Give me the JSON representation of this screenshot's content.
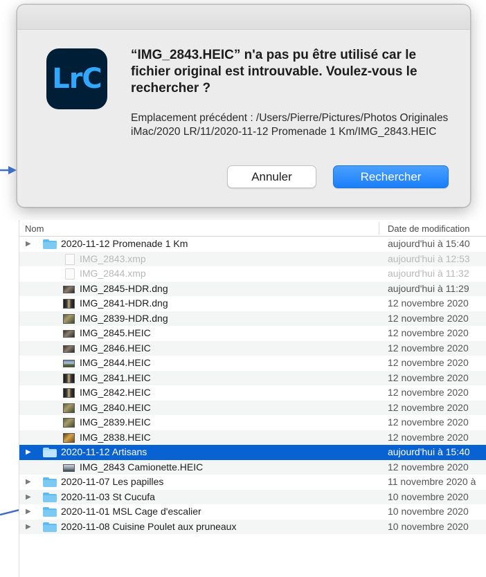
{
  "dialog": {
    "app_icon_text": "LrC",
    "message": "“IMG_2843.HEIC” n'a pas pu être utilisé car le fichier original est introuvable. Voulez-vous le rechercher ?",
    "detail": "Emplacement précédent : /Users/Pierre/Pictures/Photos Originales iMac/2020 LR/11/2020-11-12 Promenade 1 Km/IMG_2843.HEIC",
    "cancel_label": "Annuler",
    "search_label": "Rechercher",
    "colors": {
      "primary_button": "#1a7ef9",
      "app_icon_bg": "#001e36",
      "app_icon_fg": "#31a8ff"
    }
  },
  "finder": {
    "columns": {
      "name": "Nom",
      "date": "Date de modification"
    },
    "rows": [
      {
        "type": "folder",
        "expanded": false,
        "name": "2020-11-12 Promenade 1 Km",
        "date": "aujourd'hui à 15:40"
      },
      {
        "type": "file",
        "icon": "document-icon",
        "dimmed": true,
        "name": "IMG_2843.xmp",
        "date": "aujourd'hui à 12:53"
      },
      {
        "type": "file",
        "icon": "document-icon",
        "dimmed": true,
        "name": "IMG_2844.xmp",
        "date": "aujourd'hui à 11:32"
      },
      {
        "type": "file",
        "icon": "image-thumbnail-icon",
        "thumb": "t-dark",
        "orientation": "landscape",
        "name": "IMG_2845-HDR.dng",
        "date": "aujourd'hui à 11:29"
      },
      {
        "type": "file",
        "icon": "image-thumbnail-icon",
        "thumb": "t-tunnel",
        "orientation": "portrait",
        "name": "IMG_2841-HDR.dng",
        "date": "12 novembre 2020"
      },
      {
        "type": "file",
        "icon": "image-thumbnail-icon",
        "thumb": "t-green",
        "orientation": "portrait",
        "name": "IMG_2839-HDR.dng",
        "date": "12 novembre 2020"
      },
      {
        "type": "file",
        "icon": "image-thumbnail-icon",
        "thumb": "t-dark",
        "orientation": "landscape",
        "name": "IMG_2845.HEIC",
        "date": "12 novembre 2020"
      },
      {
        "type": "file",
        "icon": "image-thumbnail-icon",
        "thumb": "t-dark",
        "orientation": "landscape",
        "name": "IMG_2846.HEIC",
        "date": "12 novembre 2020"
      },
      {
        "type": "file",
        "icon": "image-thumbnail-icon",
        "thumb": "t-sky",
        "orientation": "landscape",
        "name": "IMG_2844.HEIC",
        "date": "12 novembre 2020"
      },
      {
        "type": "file",
        "icon": "image-thumbnail-icon",
        "thumb": "t-tunnel",
        "orientation": "portrait",
        "name": "IMG_2841.HEIC",
        "date": "12 novembre 2020"
      },
      {
        "type": "file",
        "icon": "image-thumbnail-icon",
        "thumb": "t-tunnel",
        "orientation": "portrait",
        "name": "IMG_2842.HEIC",
        "date": "12 novembre 2020"
      },
      {
        "type": "file",
        "icon": "image-thumbnail-icon",
        "thumb": "t-green",
        "orientation": "portrait",
        "name": "IMG_2840.HEIC",
        "date": "12 novembre 2020"
      },
      {
        "type": "file",
        "icon": "image-thumbnail-icon",
        "thumb": "t-green",
        "orientation": "portrait",
        "name": "IMG_2839.HEIC",
        "date": "12 novembre 2020"
      },
      {
        "type": "file",
        "icon": "image-thumbnail-icon",
        "thumb": "t-warm",
        "orientation": "portrait",
        "name": "IMG_2838.HEIC",
        "date": "12 novembre 2020"
      },
      {
        "type": "folder",
        "expanded": false,
        "selected": true,
        "name": "2020-11-12 Artisans",
        "date": "aujourd'hui à 15:40"
      },
      {
        "type": "file",
        "icon": "image-thumbnail-icon",
        "thumb": "t-van",
        "orientation": "landscape",
        "name": "IMG_2843 Camionette.HEIC",
        "date": "12 novembre 2020"
      },
      {
        "type": "folder",
        "expanded": false,
        "name": "2020-11-07 Les papilles",
        "date": "11 novembre 2020 à"
      },
      {
        "type": "folder",
        "expanded": false,
        "name": "2020-11-03 St Cucufa",
        "date": "10 novembre 2020"
      },
      {
        "type": "folder",
        "expanded": false,
        "name": "2020-11-01 MSL Cage d'escalier",
        "date": "10 novembre 2020"
      },
      {
        "type": "folder",
        "expanded": false,
        "name": "2020-11-08 Cuisine Poulet aux pruneaux",
        "date": "10 novembre 2020"
      }
    ],
    "colors": {
      "selection": "#0862d1",
      "folder": "#7ccaf4",
      "alt_row": "#f4f5f5"
    }
  },
  "annotations": {
    "arrow_color": "#3f6fc4"
  }
}
